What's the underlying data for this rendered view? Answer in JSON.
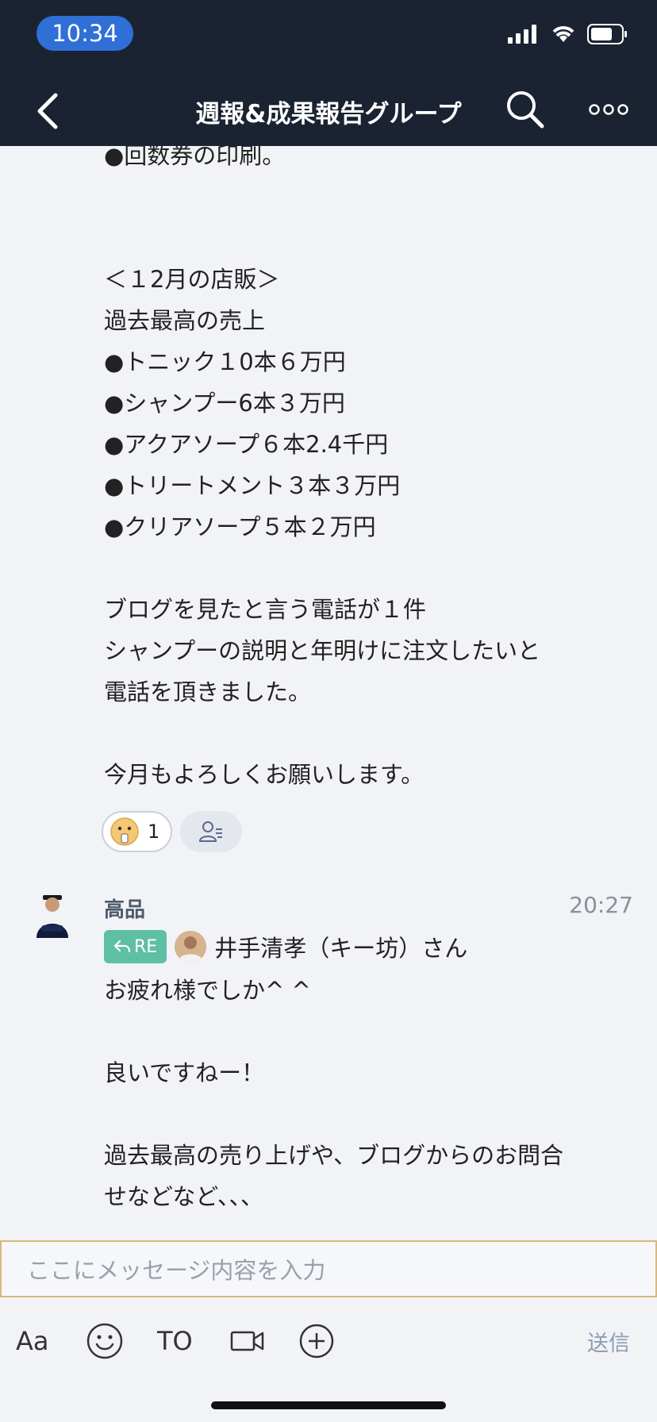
{
  "status_bar": {
    "time": "10:34"
  },
  "header": {
    "title": "週報&成果報告グループ"
  },
  "message1": {
    "text": "●回数券の印刷。\n\n\n＜１2月の店販＞\n過去最高の売上\n●トニック１0本６万円\n●シャンプー6本３万円\n●アクアソープ６本2.4千円\n●トリートメント３本３万円\n●クリアソープ５本２万円\n\nブログを見たと言う電話が１件\nシャンプーの説明と年明けに注文したいと\n電話を頂きました。\n\n今月もよろしくお願いします。",
    "reaction_count": "1"
  },
  "message2": {
    "sender": "高品",
    "time": "20:27",
    "re_label": "RE",
    "reply_to": "井手清孝（キー坊）さん",
    "text": "お疲れ様でしか^ ^\n\n良いですねー！\n\n過去最高の売り上げや、ブログからのお問合\nせなどなど、、、"
  },
  "composer": {
    "placeholder": "ここにメッセージ内容を入力"
  },
  "toolbar": {
    "aa": "Aa",
    "to": "TO",
    "send": "送信"
  }
}
